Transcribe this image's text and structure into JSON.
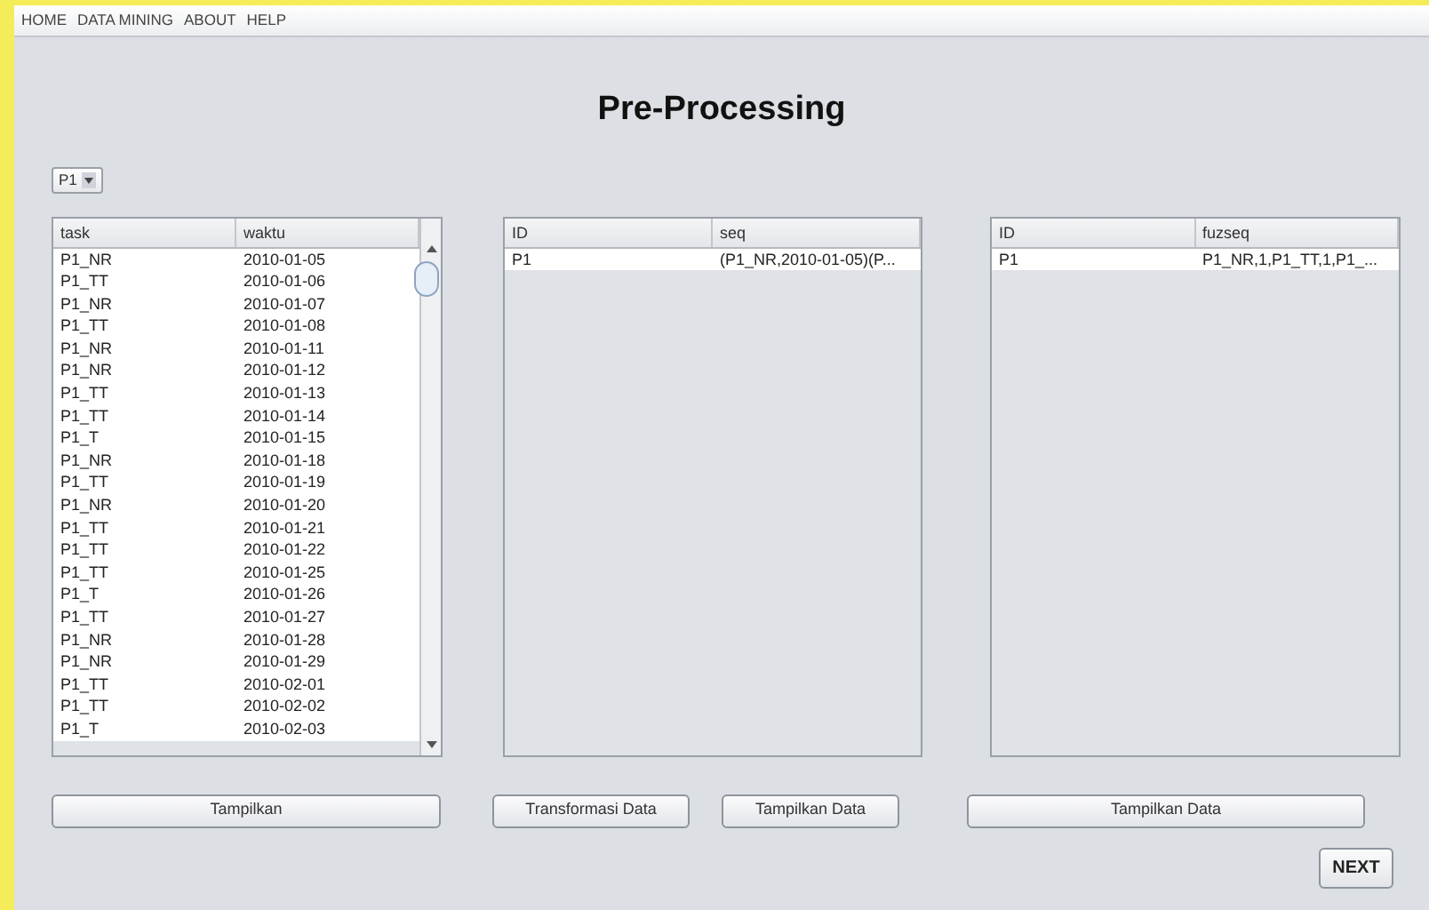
{
  "menu": [
    "HOME",
    "DATA MINING",
    "ABOUT",
    "HELP"
  ],
  "title": "Pre-Processing",
  "selector": {
    "value": "P1"
  },
  "tables": [
    {
      "columns": [
        "task",
        "waktu"
      ],
      "scrollbar": true,
      "rows": [
        [
          "P1_NR",
          "2010-01-05"
        ],
        [
          "P1_TT",
          "2010-01-06"
        ],
        [
          "P1_NR",
          "2010-01-07"
        ],
        [
          "P1_TT",
          "2010-01-08"
        ],
        [
          "P1_NR",
          "2010-01-11"
        ],
        [
          "P1_NR",
          "2010-01-12"
        ],
        [
          "P1_TT",
          "2010-01-13"
        ],
        [
          "P1_TT",
          "2010-01-14"
        ],
        [
          "P1_T",
          "2010-01-15"
        ],
        [
          "P1_NR",
          "2010-01-18"
        ],
        [
          "P1_TT",
          "2010-01-19"
        ],
        [
          "P1_NR",
          "2010-01-20"
        ],
        [
          "P1_TT",
          "2010-01-21"
        ],
        [
          "P1_TT",
          "2010-01-22"
        ],
        [
          "P1_TT",
          "2010-01-25"
        ],
        [
          "P1_T",
          "2010-01-26"
        ],
        [
          "P1_TT",
          "2010-01-27"
        ],
        [
          "P1_NR",
          "2010-01-28"
        ],
        [
          "P1_NR",
          "2010-01-29"
        ],
        [
          "P1_TT",
          "2010-02-01"
        ],
        [
          "P1_TT",
          "2010-02-02"
        ],
        [
          "P1_T",
          "2010-02-03"
        ]
      ]
    },
    {
      "columns": [
        "ID",
        "seq"
      ],
      "scrollbar": false,
      "rows": [
        [
          "P1",
          "(P1_NR,2010-01-05)(P..."
        ]
      ]
    },
    {
      "columns": [
        "ID",
        "fuzseq"
      ],
      "scrollbar": false,
      "rows": [
        [
          "P1",
          "P1_NR,1,P1_TT,1,P1_..."
        ]
      ]
    }
  ],
  "buttons": [
    [
      "Tampilkan"
    ],
    [
      "Transformasi Data",
      "Tampilkan Data"
    ],
    [
      "Tampilkan Data"
    ]
  ],
  "next_button": "NEXT"
}
